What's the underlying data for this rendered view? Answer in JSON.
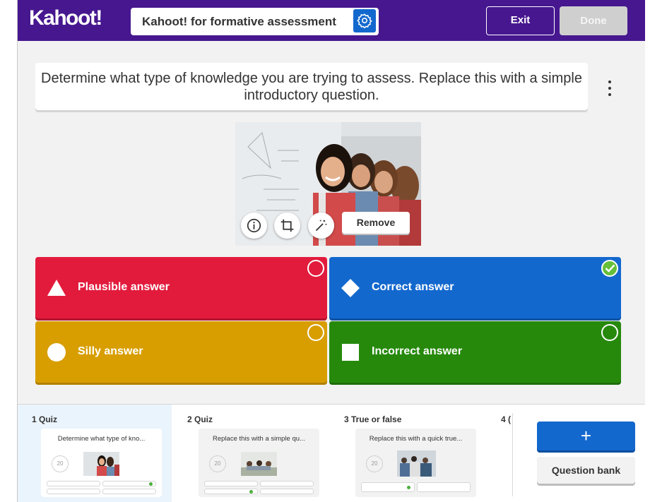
{
  "header": {
    "logo": "Kahoot!",
    "title": "Kahoot! for formative assessment",
    "exit_label": "Exit",
    "done_label": "Done"
  },
  "question": {
    "text": "Determine what type of knowledge you are trying to assess. Replace this with a simple introductory question."
  },
  "media": {
    "remove_label": "Remove",
    "tools": [
      "info-icon",
      "crop-icon",
      "magic-wand-icon"
    ]
  },
  "answers": [
    {
      "label": "Plausible answer",
      "shape": "triangle",
      "color": "#e21b3c",
      "correct": false
    },
    {
      "label": "Correct answer",
      "shape": "diamond",
      "color": "#1368ce",
      "correct": true
    },
    {
      "label": "Silly answer",
      "shape": "circle",
      "color": "#d89e00",
      "correct": false
    },
    {
      "label": "Incorrect answer",
      "shape": "square",
      "color": "#26890c",
      "correct": false
    }
  ],
  "slides": [
    {
      "label": "1 Quiz",
      "question": "Determine what type of kno...",
      "timer": "20"
    },
    {
      "label": "2 Quiz",
      "question": "Replace this with a simple qu...",
      "timer": "20"
    },
    {
      "label": "3 True or false",
      "question": "Replace this with a quick true...",
      "timer": "20"
    },
    {
      "label": "4 ("
    }
  ],
  "sidebar": {
    "add_label": "+",
    "question_bank_label": "Question bank"
  },
  "colors": {
    "brand_purple": "#46178f",
    "blue": "#1368ce",
    "correct_green": "#66bf39"
  }
}
